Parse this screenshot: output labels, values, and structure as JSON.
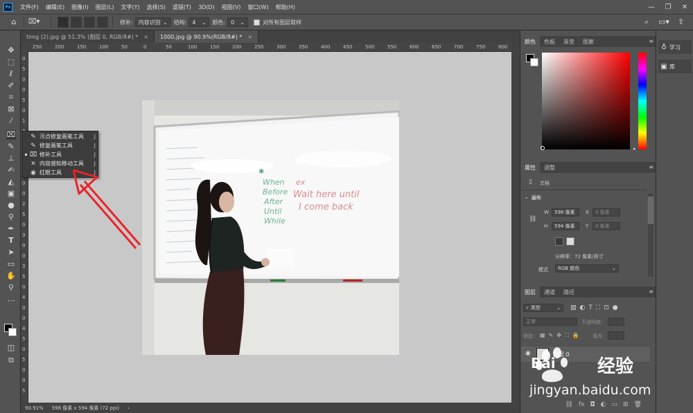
{
  "menubar": {
    "logo": "Ps",
    "items": [
      "文件(F)",
      "编辑(E)",
      "图像(I)",
      "图层(L)",
      "文字(Y)",
      "选择(S)",
      "滤镜(T)",
      "3D(D)",
      "视图(V)",
      "窗口(W)",
      "帮助(H)"
    ],
    "window_controls": [
      "—",
      "❐",
      "✕"
    ]
  },
  "options": {
    "patch_label": "修补:",
    "patch_value": "内容识别",
    "structure_label": "结构:",
    "structure_value": "4",
    "color_label": "颜色:",
    "color_value": "0",
    "sample_all_label": "对所有图层取样"
  },
  "tabs": [
    {
      "label": "timg (2).jpg @ 51.3% (图层 0, RGB/8#) *",
      "close": "×",
      "active": false
    },
    {
      "label": "1000.jpg @ 90.9%(RGB/8#) *",
      "close": "×",
      "active": true
    }
  ],
  "ruler": {
    "top_ticks": [
      "250",
      "200",
      "150",
      "100",
      "50",
      "0",
      "50",
      "100",
      "150",
      "200",
      "250",
      "300",
      "350",
      "400",
      "450",
      "500",
      "550",
      "600",
      "650",
      "700",
      "750",
      "800",
      "850"
    ],
    "left_ticks": [
      "0",
      "5",
      "0",
      "0",
      "5",
      "0",
      "1",
      "0",
      "1",
      "5",
      "0",
      "2",
      "0",
      "0",
      "2",
      "5",
      "0",
      "3",
      "0",
      "0",
      "3",
      "5",
      "0",
      "4",
      "0",
      "0",
      "4",
      "5",
      "0",
      "5",
      "0",
      "0",
      "5"
    ]
  },
  "flyout": {
    "items": [
      {
        "icon": "✎",
        "label": "污点修复画笔工具",
        "key": "J"
      },
      {
        "icon": "✎",
        "label": "修复画笔工具",
        "key": "J"
      },
      {
        "icon": "⌧",
        "label": "修补工具",
        "key": "J"
      },
      {
        "icon": "✕",
        "label": "内容感知移动工具",
        "key": "J"
      },
      {
        "icon": "◉",
        "label": "红眼工具",
        "key": "J"
      }
    ]
  },
  "whiteboard": {
    "green_lines": [
      "When",
      "Before",
      "After",
      "Until",
      "While"
    ],
    "red_lines": [
      "ex",
      "Wait here until",
      "I come back"
    ]
  },
  "statusbar": {
    "zoom": "90.91%",
    "doc_info": "598 像素 x 594 像素 (72 ppi)",
    "arrow": "›"
  },
  "color_panel": {
    "tabs": [
      "颜色",
      "色板",
      "渐变",
      "图案"
    ]
  },
  "properties_panel": {
    "tabs": [
      "属性",
      "调整"
    ],
    "doc_label": "文档",
    "canvas_label": "画布",
    "w_label": "W",
    "w_value": "598 像素",
    "h_label": "H",
    "h_value": "594 像素",
    "x_label": "X",
    "x_placeholder": "0 像素",
    "y_label": "Y",
    "y_placeholder": "0 像素",
    "resolution": "分辨率：72 像素/英寸",
    "mode_label": "模式",
    "mode_value": "RGB 颜色"
  },
  "layers_panel": {
    "tabs": [
      "图层",
      "通道",
      "路径"
    ],
    "filter_value": "类型",
    "blend_mode": "正常",
    "opacity_label": "不透明度:",
    "lock_label": "锁定:",
    "fill_label": "填充:",
    "layer_name": "图层 0"
  },
  "far_right": {
    "learn": "学习",
    "library": "库"
  },
  "watermark": {
    "brand": "Bai",
    "product": "经验",
    "url": "jingyan.baidu.com"
  },
  "colors": {
    "annotation_arrow": "#e8232a",
    "accent_blue": "#31a8ff"
  }
}
